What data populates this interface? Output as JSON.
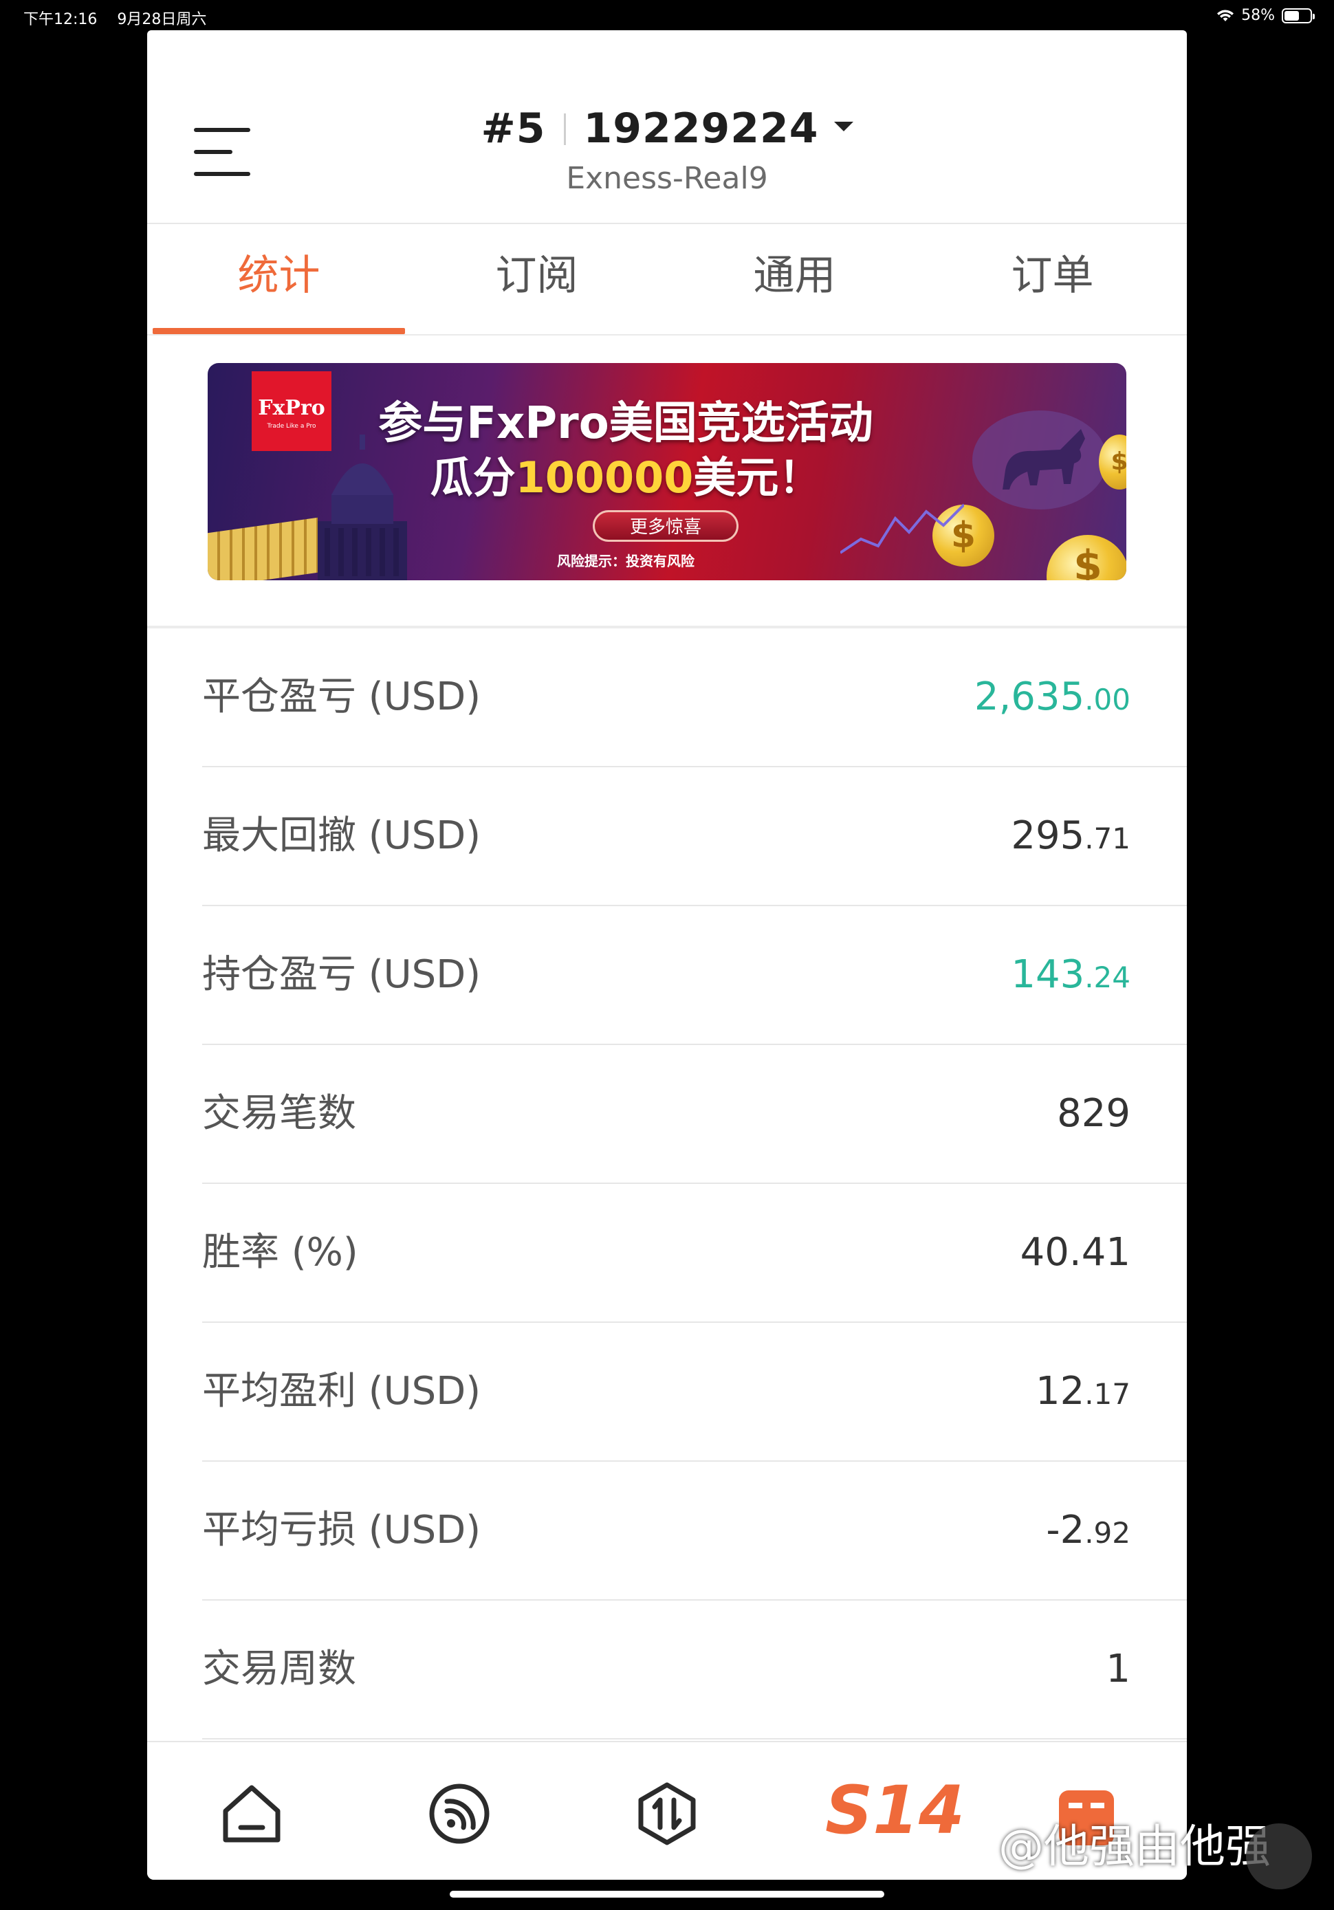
{
  "status_bar": {
    "time": "下午12:16",
    "date": "9月28日周六",
    "battery_text": "58%",
    "battery_level": 0.58
  },
  "header": {
    "account_index": "#5",
    "account_number": "19229224",
    "server": "Exness-Real9",
    "menu_icon": "hamburger-menu-icon",
    "dropdown_icon": "caret-down-icon"
  },
  "tabs": [
    {
      "label": "统计",
      "active": true
    },
    {
      "label": "订阅",
      "active": false
    },
    {
      "label": "通用",
      "active": false
    },
    {
      "label": "订单",
      "active": false
    }
  ],
  "banner": {
    "brand": "FxPro",
    "brand_tagline": "Trade Like a Pro",
    "line1": "参与FxPro美国竞选活动",
    "line2_prefix": "瓜分",
    "line2_highlight": "100000",
    "line2_suffix": "美元！",
    "button": "更多惊喜",
    "risk_notice": "风险提示：投资有风险",
    "colors": {
      "brand_red": "#e1162b",
      "highlight": "#ffd43a"
    }
  },
  "stats": [
    {
      "label": "平仓盈亏 (USD)",
      "int": "2,635",
      "dec": ".00",
      "positive": true
    },
    {
      "label": "最大回撤 (USD)",
      "int": "295",
      "dec": ".71",
      "positive": false
    },
    {
      "label": "持仓盈亏 (USD)",
      "int": "143",
      "dec": ".24",
      "positive": true
    },
    {
      "label": "交易笔数",
      "int": "829",
      "dec": "",
      "positive": false
    },
    {
      "label": "胜率 (%)",
      "int": "40.41",
      "dec": "",
      "positive": false
    },
    {
      "label": "平均盈利 (USD)",
      "int": "12",
      "dec": ".17",
      "positive": false
    },
    {
      "label": "平均亏损 (USD)",
      "int": "-2",
      "dec": ".92",
      "positive": false
    },
    {
      "label": "交易周数",
      "int": "1",
      "dec": "",
      "positive": false
    }
  ],
  "tab_bar": {
    "items": [
      {
        "icon": "home-icon"
      },
      {
        "icon": "signal-feed-icon"
      },
      {
        "icon": "trade-arrows-icon"
      },
      {
        "icon": "s14-brand-icon",
        "label": "S14"
      },
      {
        "icon": "calendar-icon"
      }
    ]
  },
  "watermark": "@他强由他强",
  "colors": {
    "accent": "#ef6a3a",
    "positive": "#29b69a",
    "text": "#333333",
    "label": "#555555"
  }
}
